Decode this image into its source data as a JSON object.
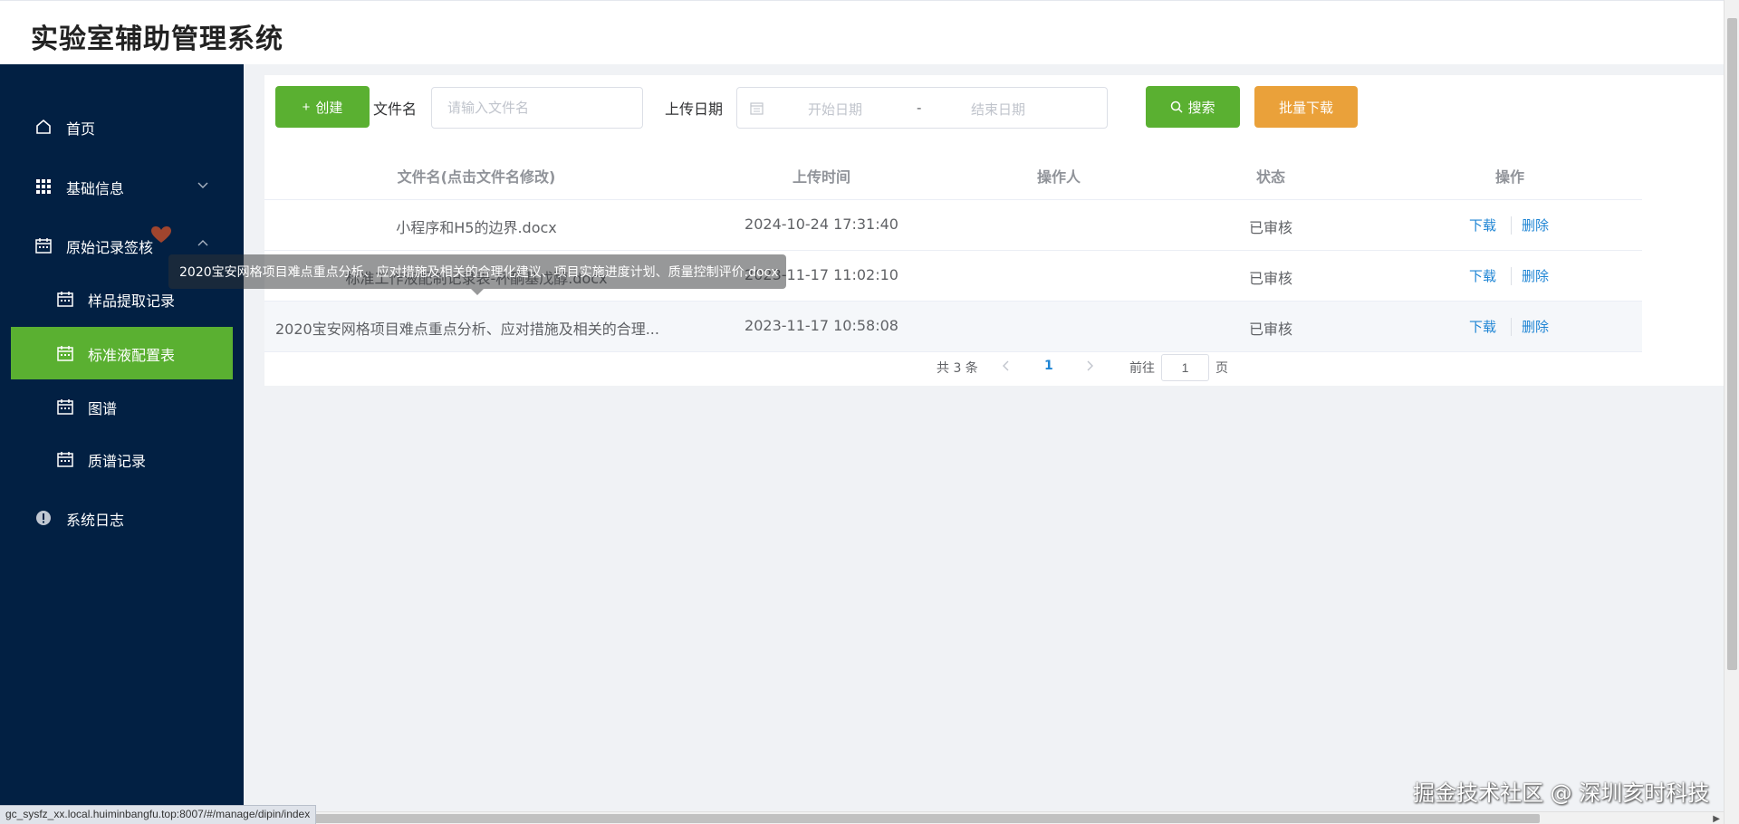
{
  "header": {
    "title": "实验室辅助管理系统"
  },
  "sidebar": {
    "items": [
      {
        "label": "首页"
      },
      {
        "label": "基础信息"
      },
      {
        "label": "原始记录签核"
      },
      {
        "label": "样品提取记录"
      },
      {
        "label": "标准液配置表"
      },
      {
        "label": "图谱"
      },
      {
        "label": "质谱记录"
      },
      {
        "label": "系统日志"
      }
    ],
    "active": "标准液配置表"
  },
  "toolbar": {
    "create_label": "创建",
    "filename_label": "文件名",
    "filename_placeholder": "请输入文件名",
    "date_label": "上传日期",
    "start_placeholder": "开始日期",
    "date_separator": "-",
    "end_placeholder": "结束日期",
    "search_label": "搜索",
    "batch_download_label": "批量下载"
  },
  "table": {
    "columns": [
      "文件名(点击文件名修改)",
      "上传时间",
      "操作人",
      "状态",
      "操作"
    ],
    "rows": [
      {
        "filename": "小程序和H5的边界.docx",
        "time": "2024-10-24 17:31:40",
        "operator": "",
        "status": "已审核",
        "download": "下载",
        "delete": "删除"
      },
      {
        "filename": "标准工作液配制记录表-杯酮基戊醇.docx",
        "time": "2023-11-17 11:02:10",
        "operator": "",
        "status": "已审核",
        "download": "下载",
        "delete": "删除"
      },
      {
        "filename": "2020宝安网格项目难点重点分析、应对措施及相关的合理...",
        "time": "2023-11-17 10:58:08",
        "operator": "",
        "status": "已审核",
        "download": "下载",
        "delete": "删除"
      }
    ]
  },
  "pagination": {
    "total_text": "共 3 条",
    "current_page": "1",
    "goto_label": "前往",
    "goto_value": "1",
    "page_unit": "页"
  },
  "tooltip": {
    "text": "2020宝安网格项目难点重点分析、应对措施及相关的合理化建议、项目实施进度计划、质量控制评价.docx"
  },
  "status_bar": {
    "url": "gc_sysfz_xx.local.huiminbangfu.top:8007/#/manage/dipin/index"
  },
  "watermark": {
    "text": "掘金技术社区 @ 深圳亥时科技"
  },
  "colors": {
    "sidebar_bg": "#022043",
    "primary_green": "#5ab031",
    "warning_orange": "#eaa13a",
    "link_blue": "#1f85d4"
  }
}
